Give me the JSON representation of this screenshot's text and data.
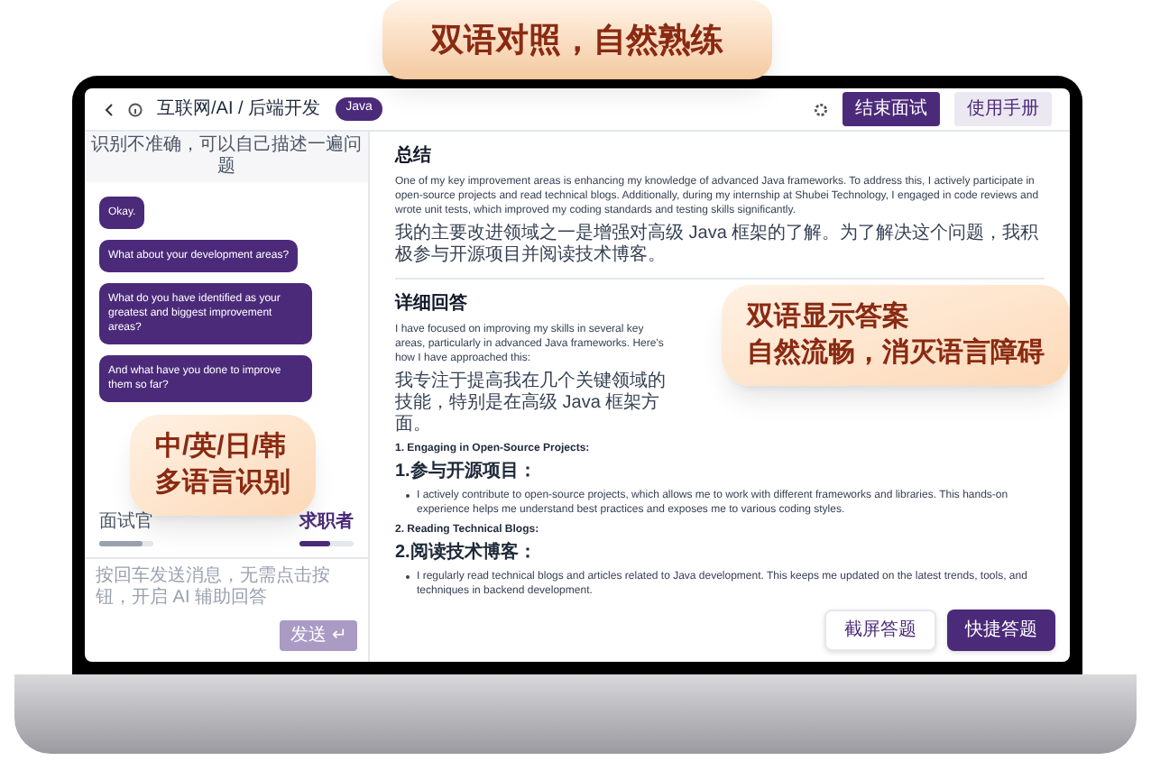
{
  "banner": "双语对照，自然熟练",
  "header": {
    "title": "互联网/AI / 后端开发",
    "badge": "Java",
    "buttons": [
      {
        "label": "结束面试",
        "kind": "primary"
      },
      {
        "label": "使用手册",
        "kind": "secondary"
      }
    ]
  },
  "chat": {
    "notice": "识别不准确，可以自己描述一遍问题",
    "messages": [
      "Okay.",
      "What about your development areas?",
      "What do you have identified as your greatest and biggest improvement areas?",
      "And what have you done to improve them so far?"
    ],
    "speakers": [
      {
        "label": "面试官",
        "selected": false,
        "level": 0.8
      },
      {
        "label": "求职者",
        "selected": true,
        "level": 0.55
      }
    ],
    "input": {
      "placeholder": "按回车发送消息，无需点击按钮，开启 AI 辅助回答"
    },
    "send": "发送 ↵"
  },
  "callouts": [
    {
      "lines": [
        "中/英/日/韩",
        "多语言识别"
      ]
    },
    {
      "lines": [
        "双语显示答案",
        "自然流畅，消灭语言障碍"
      ]
    }
  ],
  "answer": {
    "sections": [
      {
        "heading": "总结",
        "blocks": [
          {
            "kind": "para",
            "text": "One of my key improvement areas is enhancing my knowledge of advanced Java frameworks. To address this, I actively participate in open-source projects and read technical blogs. Additionally, during my internship at Shubei Technology, I engaged in code reviews and wrote unit tests, which improved my coding standards and testing skills significantly."
          },
          {
            "kind": "para",
            "text": "我的主要改进领域之一是增强对高级 Java 框架的了解。为了解决这个问题，我积极参与开源项目并阅读技术博客。"
          }
        ]
      },
      {
        "heading": "详细回答",
        "blocks": [
          {
            "kind": "para",
            "text": "I have focused on improving my skills in several key areas, particularly in advanced Java frameworks. Here's how I have approached this:"
          },
          {
            "kind": "para",
            "text": "我专注于提高我在几个关键领域的技能，特别是在高级 Java 框架方面。"
          },
          {
            "kind": "item",
            "text": "1. Engaging in Open-Source Projects:"
          },
          {
            "kind": "item",
            "text": "1.参与开源项目："
          },
          {
            "kind": "bullet",
            "text": "I actively contribute to open-source projects, which allows me to work with different frameworks and libraries. This hands-on experience helps me understand best practices and exposes me to various coding styles."
          },
          {
            "kind": "item",
            "text": "2. Reading Technical Blogs:"
          },
          {
            "kind": "item",
            "text": "2.阅读技术博客："
          },
          {
            "kind": "bullet",
            "text": "I regularly read technical blogs and articles related to Java development. This keeps me updated on the latest trends, tools, and techniques in backend development."
          }
        ]
      }
    ]
  },
  "float_buttons": [
    {
      "label": "截屏答题",
      "kind": "secondary"
    },
    {
      "label": "快捷答题",
      "kind": "primary"
    }
  ]
}
